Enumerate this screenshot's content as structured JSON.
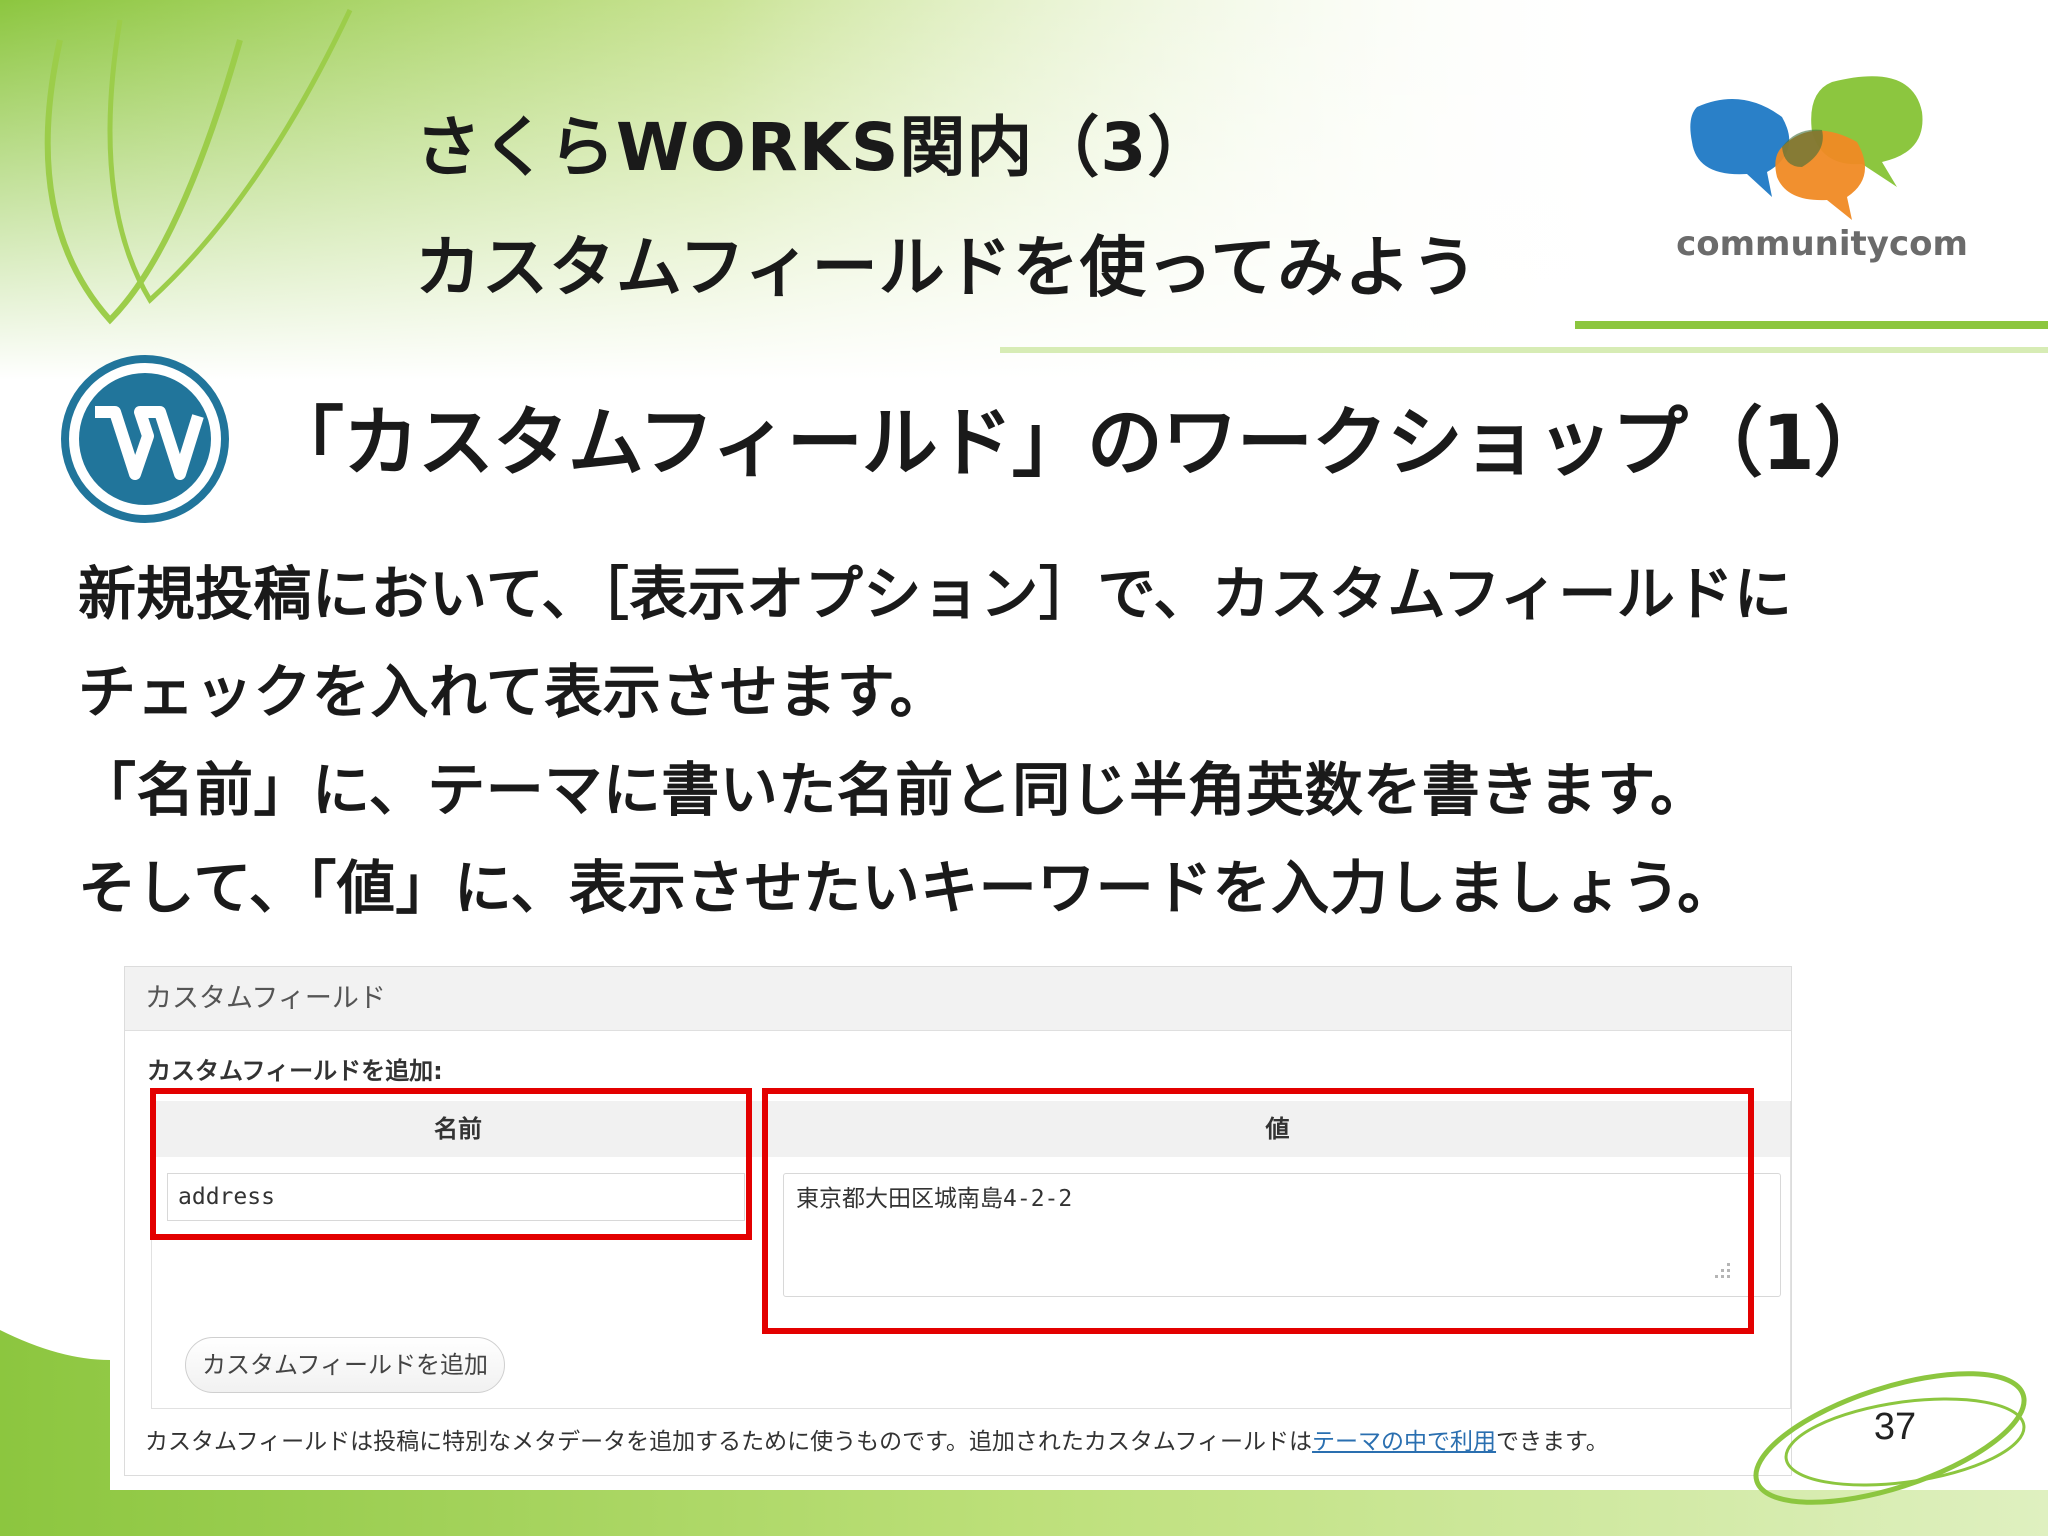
{
  "slide": {
    "title_line1": "さくらWORKS関内（3）",
    "title_line2": "カスタムフィールドを使ってみよう",
    "logo_text": "communitycom",
    "heading": "「カスタムフィールド」のワークショップ（1）",
    "body_lines": [
      "新規投稿において、［表示オプション］で、カスタムフィールドに",
      "チェックを入れて表示させます。",
      "「名前」に、テーマに書いた名前と同じ半角英数を書きます。",
      "そして、「値」に、表示させたいキーワードを入力しましょう。"
    ],
    "page_number": "37"
  },
  "panel": {
    "header": "カスタムフィールド",
    "add_label": "カスタムフィールドを追加:",
    "name_header": "名前",
    "value_header": "値",
    "name_value": "address",
    "value_value": "東京都大田区城南島4-2-2",
    "add_button": "カスタムフィールドを追加",
    "help_text_before": "カスタムフィールドは投稿に特別なメタデータを追加するために使うものです。追加されたカスタムフィールドは",
    "help_link": "テーマの中で利用",
    "help_text_after": "できます。"
  },
  "colors": {
    "accent_green": "#8cc63f",
    "highlight_red": "#e30000",
    "link_blue": "#2a6fb0",
    "wordpress_blue": "#21759b"
  }
}
